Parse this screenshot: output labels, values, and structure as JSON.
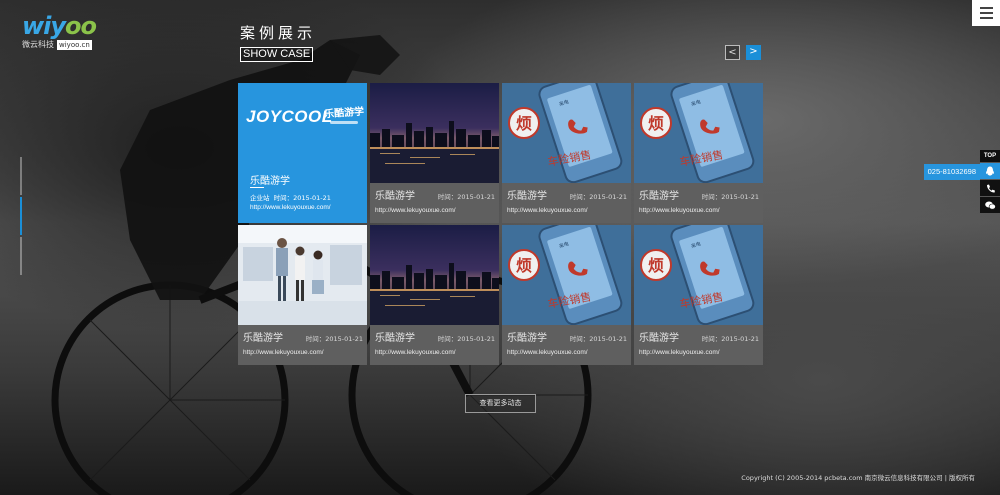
{
  "logo": {
    "mark_a": "wiy",
    "mark_b": "oo",
    "company_cn": "微云科技",
    "domain": "wiyoo.cn"
  },
  "section": {
    "title_cn": "案例展示",
    "title_en": "SHOW CASE"
  },
  "nav": {
    "prev": "<",
    "next": ">"
  },
  "featured": {
    "brand": "JOYCOOL",
    "brand_cn": "乐酷游学",
    "name": "乐酷游学",
    "category": "企业站",
    "time": "时间：2015-01-21",
    "url": "http://www.lekuyouxue.com/"
  },
  "cases": [
    {
      "name": "乐酷游学",
      "time": "时间：2015-01-21",
      "url": "http://www.lekuyouxue.com/",
      "thumb": "city"
    },
    {
      "name": "乐酷游学",
      "time": "时间：2015-01-21",
      "url": "http://www.lekuyouxue.com/",
      "thumb": "phone"
    },
    {
      "name": "乐酷游学",
      "time": "时间：2015-01-21",
      "url": "http://www.lekuyouxue.com/",
      "thumb": "phone"
    },
    {
      "name": "乐酷游学",
      "time": "时间：2015-01-21",
      "url": "http://www.lekuyouxue.com/",
      "thumb": "office"
    },
    {
      "name": "乐酷游学",
      "time": "时间：2015-01-21",
      "url": "http://www.lekuyouxue.com/",
      "thumb": "city"
    },
    {
      "name": "乐酷游学",
      "time": "时间：2015-01-21",
      "url": "http://www.lekuyouxue.com/",
      "thumb": "phone"
    },
    {
      "name": "乐酷游学",
      "time": "时间：2015-01-21",
      "url": "http://www.lekuyouxue.com/",
      "thumb": "phone"
    }
  ],
  "phone_thumb": {
    "badge": "烦",
    "caption": "车险销售",
    "screen_label": "来电"
  },
  "more_button": "查看更多动态",
  "right_tools": {
    "top": "TOP",
    "phone": "025-81032698",
    "qq_icon": "qq-icon",
    "phone_icon": "phone-icon",
    "wechat_icon": "wechat-icon"
  },
  "footer": "Copyright (C) 2005-2014 pcbeta.com   南京微云信息科技有限公司  |  版权所有",
  "colors": {
    "accent": "#2795de",
    "card_info": "#5f5f5f",
    "logo_green": "#8bc34a"
  }
}
